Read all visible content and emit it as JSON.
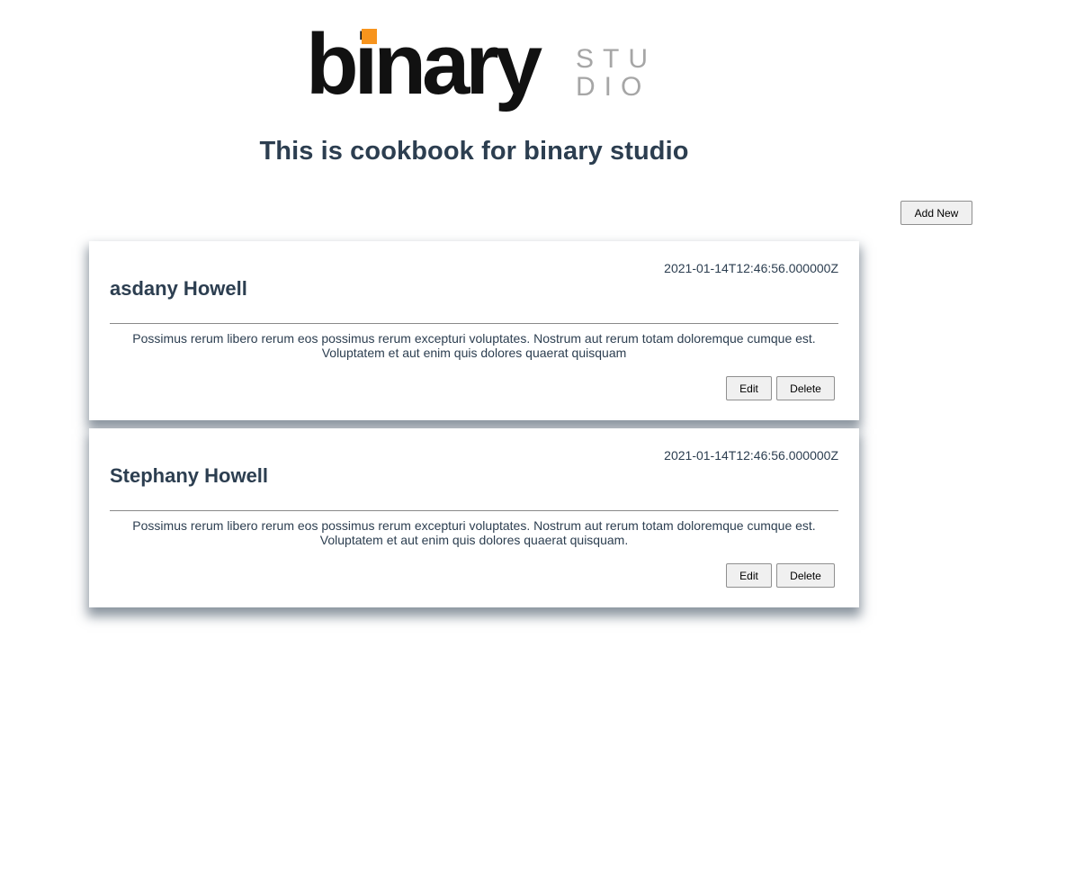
{
  "brand": {
    "logo_word": "binary",
    "logo_sub_line1": "STU",
    "logo_sub_line2": "DIO",
    "accent_color": "#f7941d",
    "text_color": "#111111",
    "sub_color": "#a6a6a6"
  },
  "header": {
    "title": "This is cookbook for binary studio"
  },
  "toolbar": {
    "add_new_label": "Add New"
  },
  "recipes": [
    {
      "title": "asdany Howell",
      "date": "2021-01-14T12:46:56.000000Z",
      "description": "Possimus rerum libero rerum eos possimus rerum excepturi voluptates. Nostrum aut rerum totam doloremque cumque est. Voluptatem et aut enim quis dolores quaerat quisquam",
      "edit_label": "Edit",
      "delete_label": "Delete"
    },
    {
      "title": "Stephany Howell",
      "date": "2021-01-14T12:46:56.000000Z",
      "description": "Possimus rerum libero rerum eos possimus rerum excepturi voluptates. Nostrum aut rerum totam doloremque cumque est. Voluptatem et aut enim quis dolores quaerat quisquam.",
      "edit_label": "Edit",
      "delete_label": "Delete"
    }
  ],
  "colors": {
    "heading": "#2c3e50",
    "button_bg": "#f0f0f0",
    "button_border": "#8f8f8f"
  }
}
